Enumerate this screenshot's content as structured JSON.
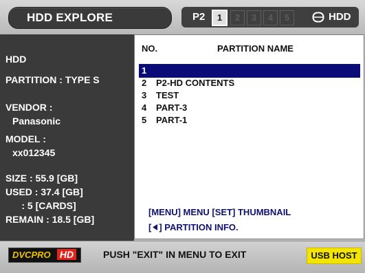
{
  "header": {
    "title": "HDD EXPLORE",
    "media_label": "P2",
    "slots": [
      "1",
      "2",
      "3",
      "4",
      "5"
    ],
    "active_slot": "1",
    "hdd_label": "HDD",
    "hdd_icon": "hdd-drive-icon"
  },
  "info": {
    "device": "HDD",
    "partition": "PARTITION : TYPE S",
    "vendor_label": "VENDOR :",
    "vendor_value": "Panasonic",
    "model_label": "MODEL :",
    "model_value": "xx012345",
    "size": "SIZE : 55.9 [GB]",
    "used": "USED : 37.4 [GB]",
    "cards": "      : 5 [CARDS]",
    "remain": "REMAIN : 18.5 [GB]"
  },
  "table": {
    "col_no": "NO.",
    "col_name": "PARTITION NAME",
    "rows": [
      {
        "no": "1",
        "name": ""
      },
      {
        "no": "2",
        "name": "P2-HD  CONTENTS"
      },
      {
        "no": "3",
        "name": "TEST"
      },
      {
        "no": "4",
        "name": "PART-3"
      },
      {
        "no": "5",
        "name": "PART-1"
      }
    ],
    "selected_row": "1"
  },
  "help": {
    "line1": "[MENU] MENU   [SET] THUMBNAIL",
    "line2_prefix": "[",
    "line2_icon": "left-arrow-icon",
    "line2_suffix": "] PARTITION INFO."
  },
  "footer": {
    "logo_text": "DVCPRO",
    "logo_hd": "HD",
    "message": "PUSH \"EXIT\" IN MENU TO EXIT",
    "usb_badge": "USB HOST"
  },
  "colors": {
    "selection": "#0c0c78",
    "help_text": "#101070",
    "usb_badge": "#f4e500",
    "logo_hd": "#e2231a",
    "logo_text": "#f2c200"
  }
}
